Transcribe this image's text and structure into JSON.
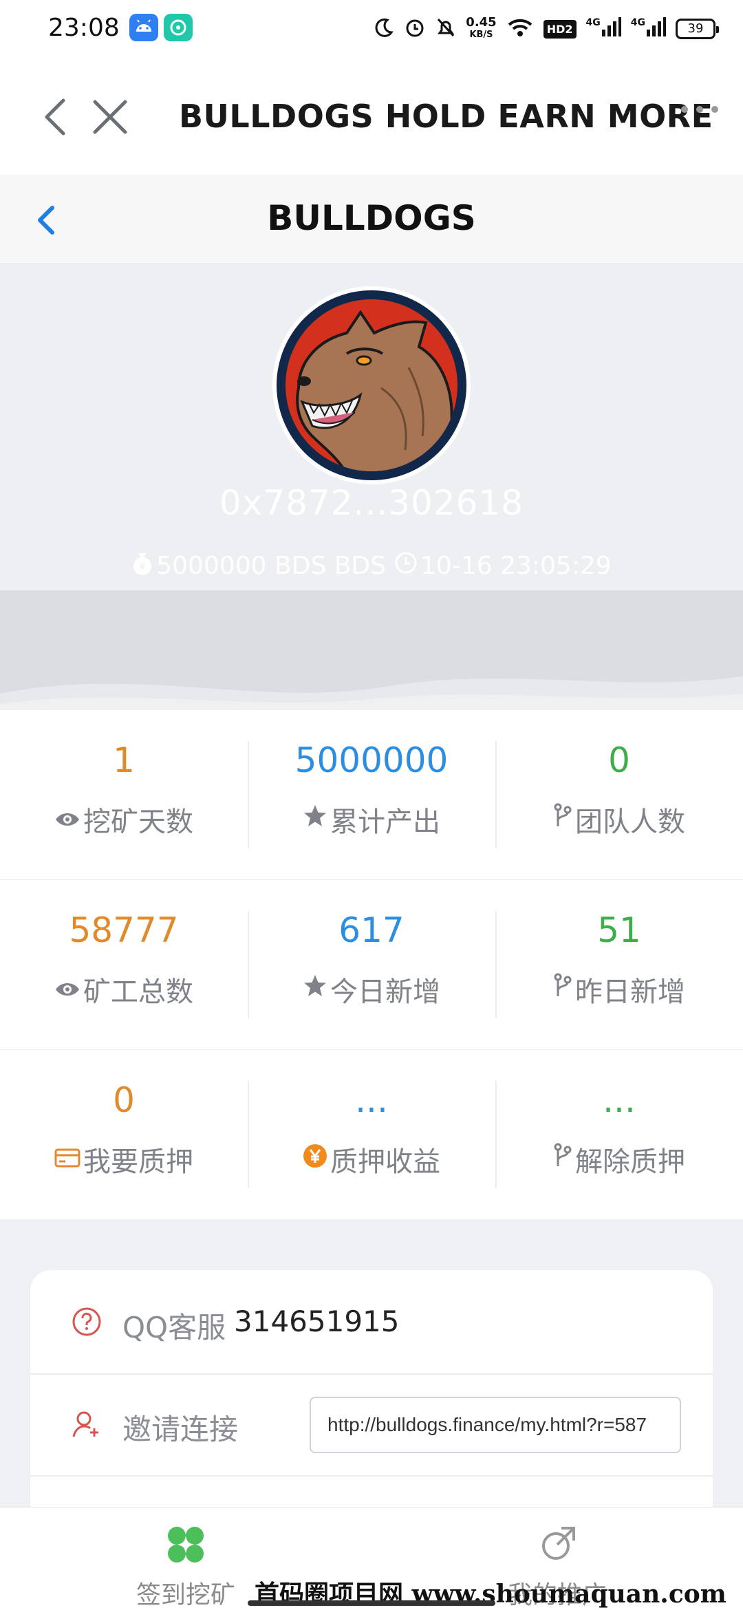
{
  "status_bar": {
    "time": "23:08",
    "speed_value": "0.45",
    "speed_unit": "KB/S",
    "hd_badge": "HD2",
    "net1": "4G",
    "net2": "4G",
    "battery": "39"
  },
  "browser": {
    "title": "BULLDOGS HOLD EARN MORE"
  },
  "page": {
    "title": "BULLDOGS"
  },
  "hero": {
    "address": "0x7872...302618",
    "balance": "5000000 BDS BDS",
    "timestamp": "10-16 23:05:29"
  },
  "stats": [
    [
      {
        "value": "1",
        "label": "挖矿天数",
        "icon": "eye-icon",
        "color": "orange"
      },
      {
        "value": "5000000",
        "label": "累计产出",
        "icon": "star-icon",
        "color": "blue"
      },
      {
        "value": "0",
        "label": "团队人数",
        "icon": "branch-icon",
        "color": "green"
      }
    ],
    [
      {
        "value": "58777",
        "label": "矿工总数",
        "icon": "eye-icon",
        "color": "orange"
      },
      {
        "value": "617",
        "label": "今日新增",
        "icon": "star-icon",
        "color": "blue"
      },
      {
        "value": "51",
        "label": "昨日新增",
        "icon": "branch-icon",
        "color": "green"
      }
    ],
    [
      {
        "value": "0",
        "label": "我要质押",
        "icon": "card-icon",
        "color": "orange"
      },
      {
        "value": "...",
        "label": "质押收益",
        "icon": "yen-coin-icon",
        "color": "blue"
      },
      {
        "value": "...",
        "label": "解除质押",
        "icon": "branch-icon",
        "color": "green"
      }
    ]
  ],
  "support": {
    "label": "QQ客服",
    "value": "314651915"
  },
  "invite": {
    "label": "邀请连接",
    "url": "http://bulldogs.finance/my.html?r=587"
  },
  "tabs": [
    {
      "label": "签到挖矿",
      "icon": "mining-icon"
    },
    {
      "label": "我的推广",
      "icon": "share-icon"
    }
  ],
  "watermark": "首码圈项目网 www.shoumaquan.com",
  "colors": {
    "orange": "#e08a2c",
    "blue": "#2b8ee0",
    "green": "#3fae4a",
    "accent_blue": "#1f7fe0"
  }
}
